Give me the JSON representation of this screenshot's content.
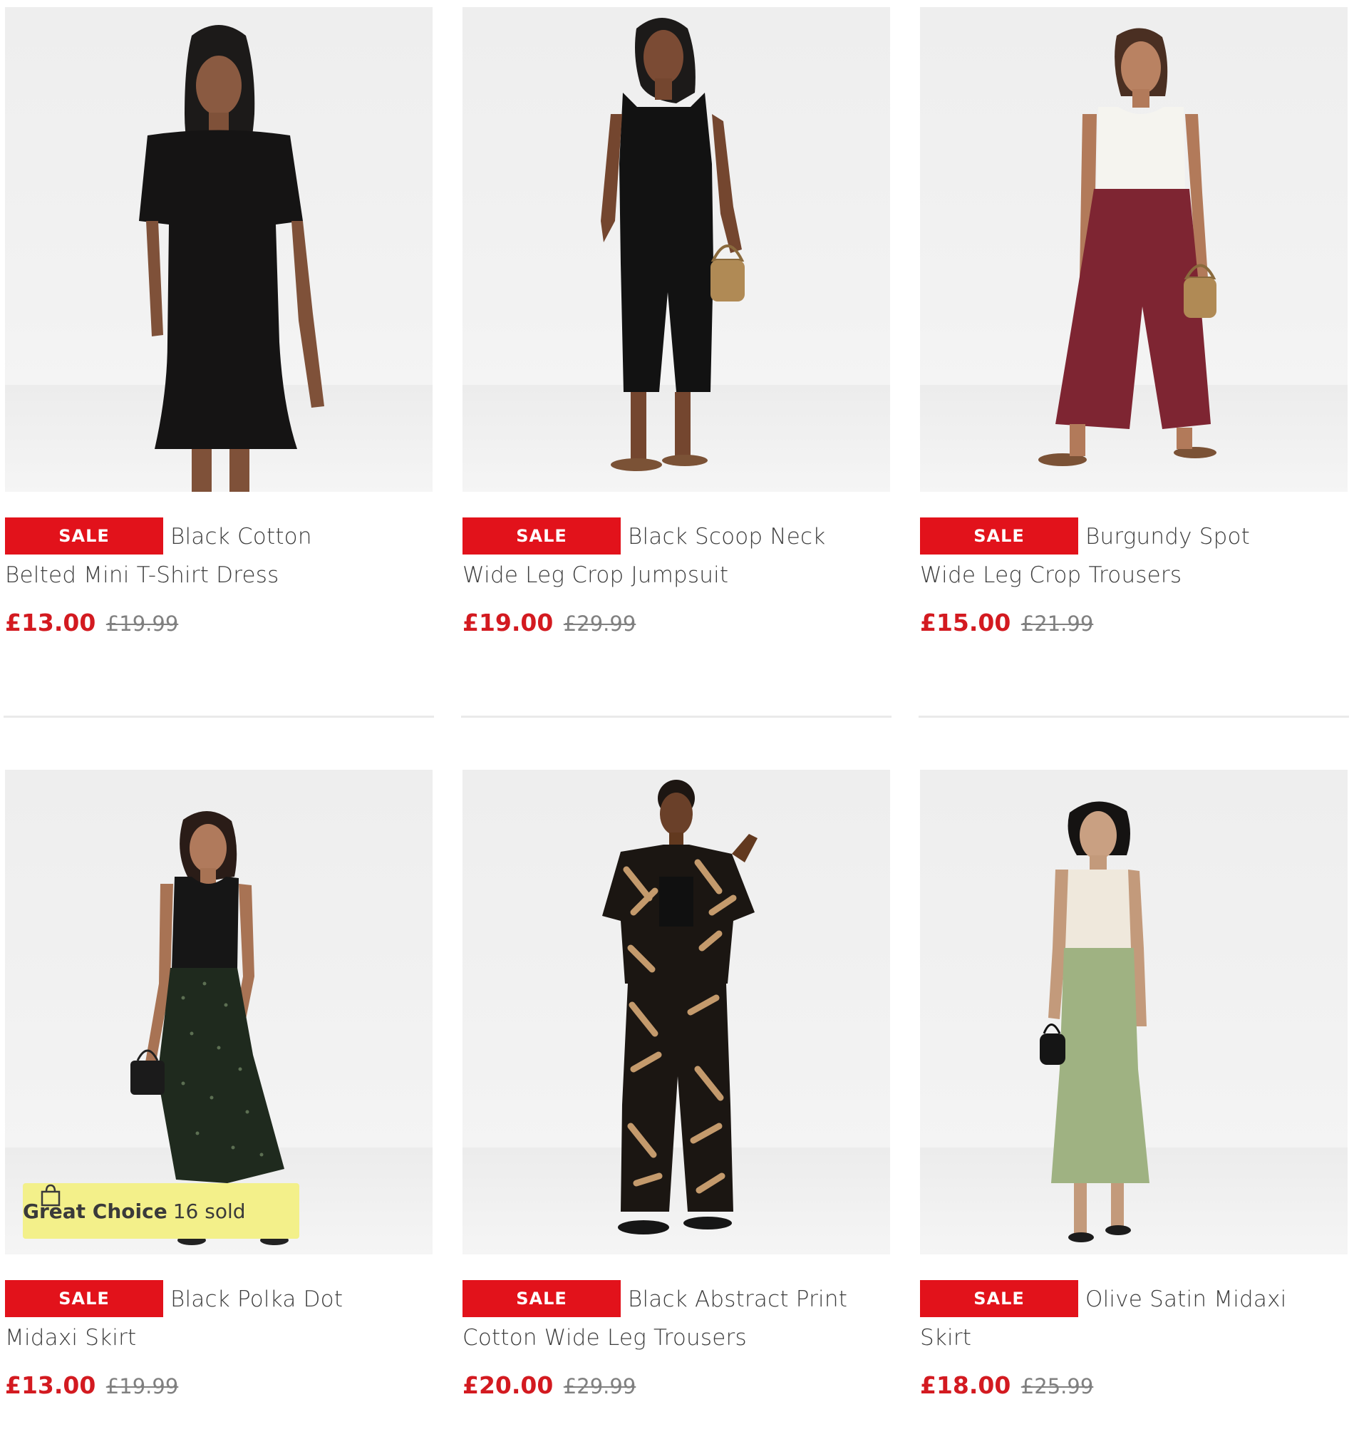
{
  "products": [
    {
      "badge": "SALE",
      "name_line1": "Black Cotton",
      "name_line2": "Belted Mini T-Shirt Dress",
      "price": "£13.00",
      "was_price": "£19.99",
      "image_desc": "black-tshirt-dress-model"
    },
    {
      "badge": "SALE",
      "name_line1": "Black Scoop Neck",
      "name_line2": "Wide Leg Crop Jumpsuit",
      "price": "£19.00",
      "was_price": "£29.99",
      "image_desc": "black-jumpsuit-model"
    },
    {
      "badge": "SALE",
      "name_line1": "Burgundy Spot",
      "name_line2": "Wide Leg Crop Trousers",
      "price": "£15.00",
      "was_price": "£21.99",
      "image_desc": "burgundy-trousers-model"
    },
    {
      "badge": "SALE",
      "name_line1": "Black Polka Dot",
      "name_line2": "Midaxi Skirt",
      "price": "£13.00",
      "was_price": "£19.99",
      "image_desc": "black-polka-skirt-model",
      "great_choice": {
        "label": "Great Choice",
        "sold": "16 sold"
      }
    },
    {
      "badge": "SALE",
      "name_line1": "Black Abstract Print",
      "name_line2": "Cotton Wide Leg Trousers",
      "price": "£20.00",
      "was_price": "£29.99",
      "image_desc": "abstract-print-set-model"
    },
    {
      "badge": "SALE",
      "name_line1": "Olive Satin Midaxi",
      "name_line2": "Skirt",
      "price": "£18.00",
      "was_price": "£25.99",
      "image_desc": "olive-satin-skirt-model"
    }
  ],
  "colors": {
    "sale": "#e2121b",
    "price": "#d31a20",
    "great_choice_bg": "#f3f08a"
  }
}
